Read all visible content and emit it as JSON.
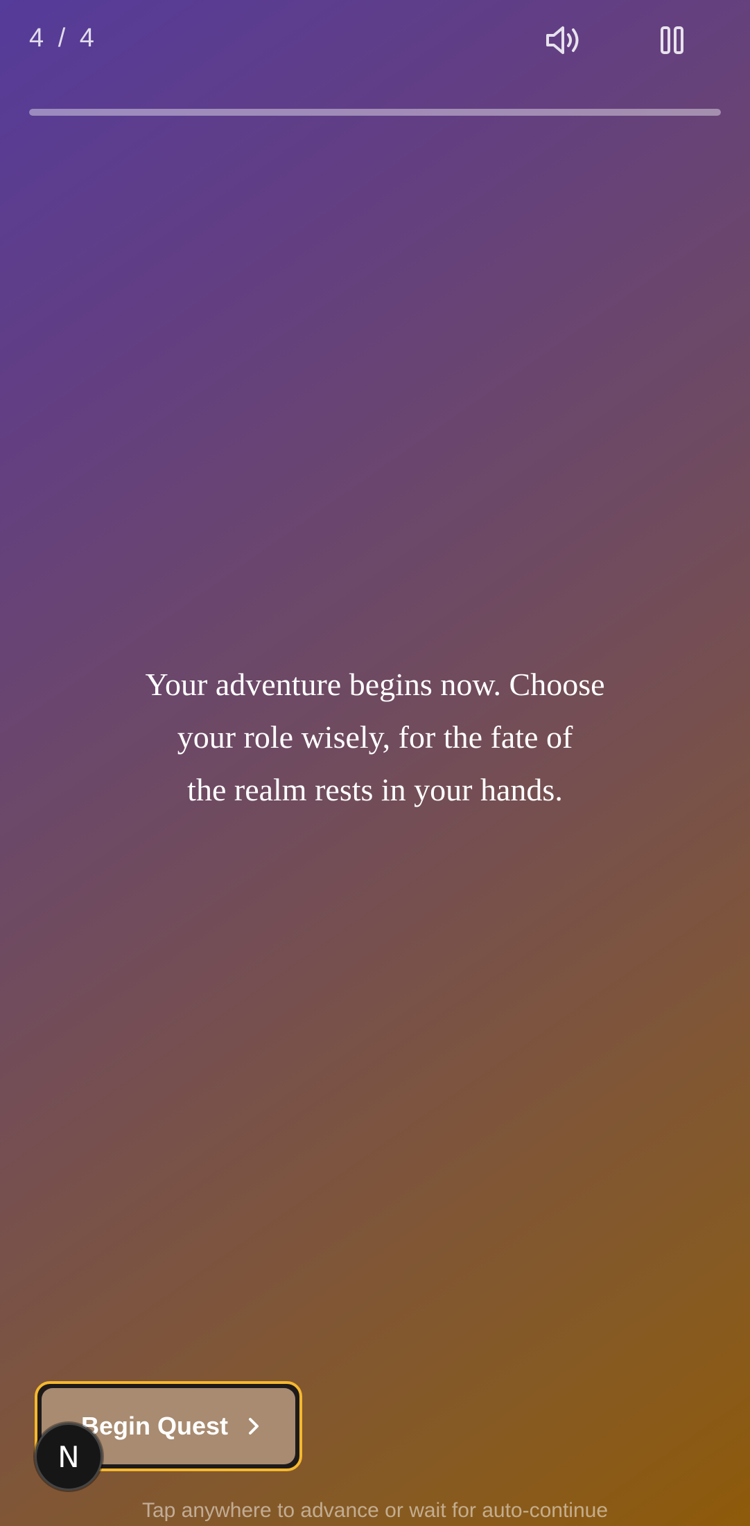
{
  "header": {
    "counter": "4 / 4",
    "sound_icon": "volume-icon",
    "pause_icon": "pause-icon"
  },
  "progress": {
    "fraction": 1.0
  },
  "story": {
    "line1": "Your adventure begins now. Choose",
    "line2": "your role wisely, for the fate of",
    "line3": "the realm rests in your hands."
  },
  "cta": {
    "label": "Begin Quest",
    "icon": "chevron-right-icon",
    "ring_color": "#f5b82e"
  },
  "avatar": {
    "letter": "N"
  },
  "hint": "Tap anywhere to advance or wait for auto-continue"
}
